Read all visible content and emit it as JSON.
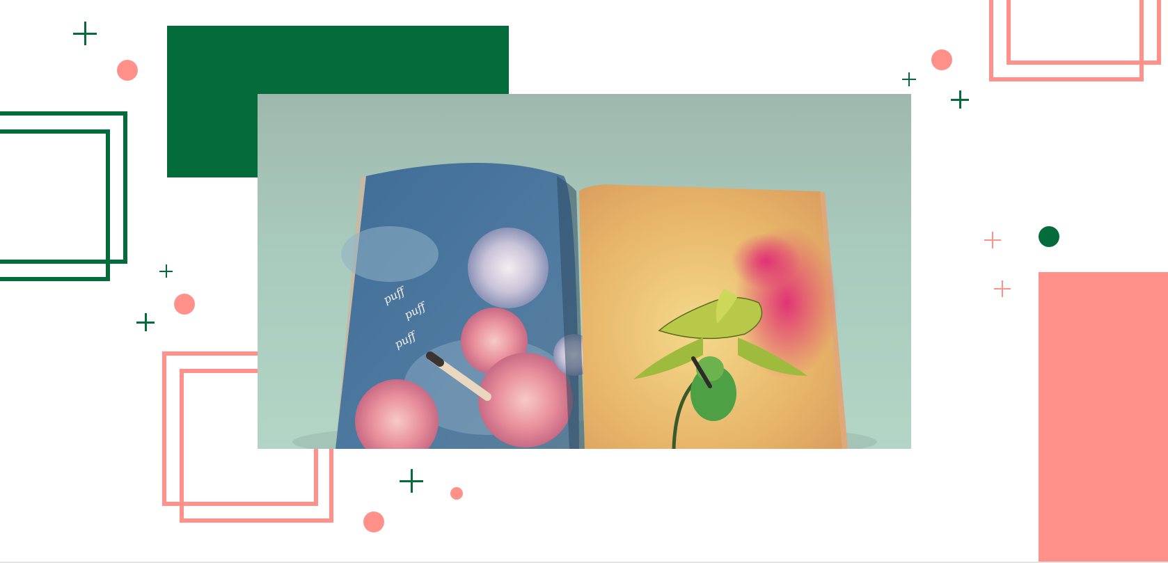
{
  "colors": {
    "accent_green": "#046b3a",
    "accent_pink": "#ff918a",
    "background": "#ffffff"
  },
  "magazine": {
    "left_page_words": [
      "puff",
      "puff",
      "puff"
    ]
  },
  "icons": [
    "plus-icon",
    "dot-icon"
  ]
}
